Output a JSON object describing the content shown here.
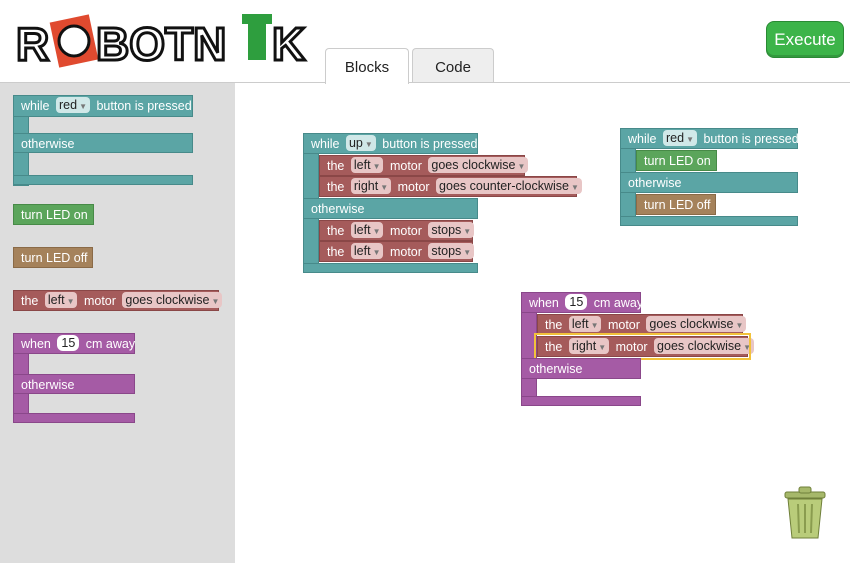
{
  "app": {
    "logo_text": "ROBOTNIK",
    "execute_label": "Execute"
  },
  "tabs": [
    {
      "label": "Blocks",
      "active": true
    },
    {
      "label": "Code",
      "active": false
    }
  ],
  "words": {
    "while": "while",
    "button_is_pressed": "button is pressed",
    "otherwise": "otherwise",
    "the": "the",
    "motor": "motor",
    "when": "when",
    "cm_away": "cm away",
    "turn_led_on": "turn LED on",
    "turn_led_off": "turn LED off"
  },
  "toolbox": {
    "while_color": "red",
    "motor_side": "left",
    "motor_action": "goes clockwise",
    "distance": "15"
  },
  "workspace": {
    "stack1": {
      "button": "up",
      "if_rows": [
        {
          "side": "left",
          "action": "goes clockwise"
        },
        {
          "side": "right",
          "action": "goes counter-clockwise"
        }
      ],
      "else_rows": [
        {
          "side": "left",
          "action": "stops"
        },
        {
          "side": "left",
          "action": "stops"
        }
      ]
    },
    "stack2": {
      "button": "red"
    },
    "stack3": {
      "distance": "15",
      "rows": [
        {
          "side": "left",
          "action": "goes clockwise"
        },
        {
          "side": "right",
          "action": "goes clockwise"
        }
      ]
    }
  },
  "colors": {
    "teal": "#5ba5a5",
    "purple": "#a55ba5",
    "motor_red": "#a55b5b",
    "green": "#5ba55b",
    "brown": "#a5825b",
    "execute_green": "#3cb449",
    "selection_outline": "#f2c23a"
  },
  "icons": {
    "trash": "trash-icon",
    "dropdown": "dropdown-arrow-icon"
  }
}
